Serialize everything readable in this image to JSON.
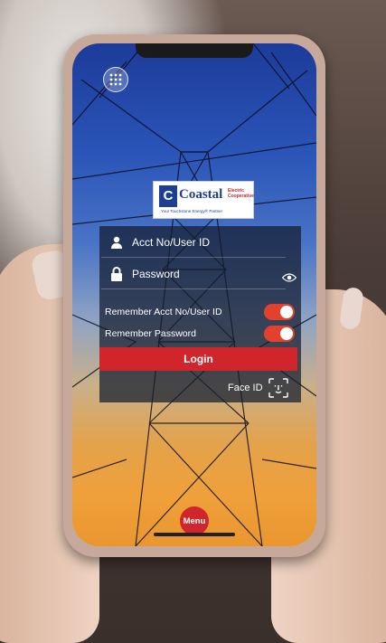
{
  "logo": {
    "letter": "C",
    "name": "Coastal",
    "sub_line1": "Electric",
    "sub_line2": "Cooperative",
    "tagline": "Your Touchstone Energy® Partner"
  },
  "login_form": {
    "account_placeholder": "Acct No/User ID",
    "password_placeholder": "Password",
    "remember_account_label": "Remember Acct No/User ID",
    "remember_account_on": true,
    "remember_password_label": "Remember Password",
    "remember_password_on": true,
    "login_label": "Login",
    "face_id_label": "Face ID"
  },
  "menu": {
    "label": "Menu"
  },
  "colors": {
    "accent_red": "#d0252a",
    "toggle_on": "#e2412e",
    "brand_blue": "#1e3f8f"
  },
  "icons": [
    "apps-grid-icon",
    "user-icon",
    "lock-icon",
    "eye-icon",
    "face-id-icon"
  ]
}
